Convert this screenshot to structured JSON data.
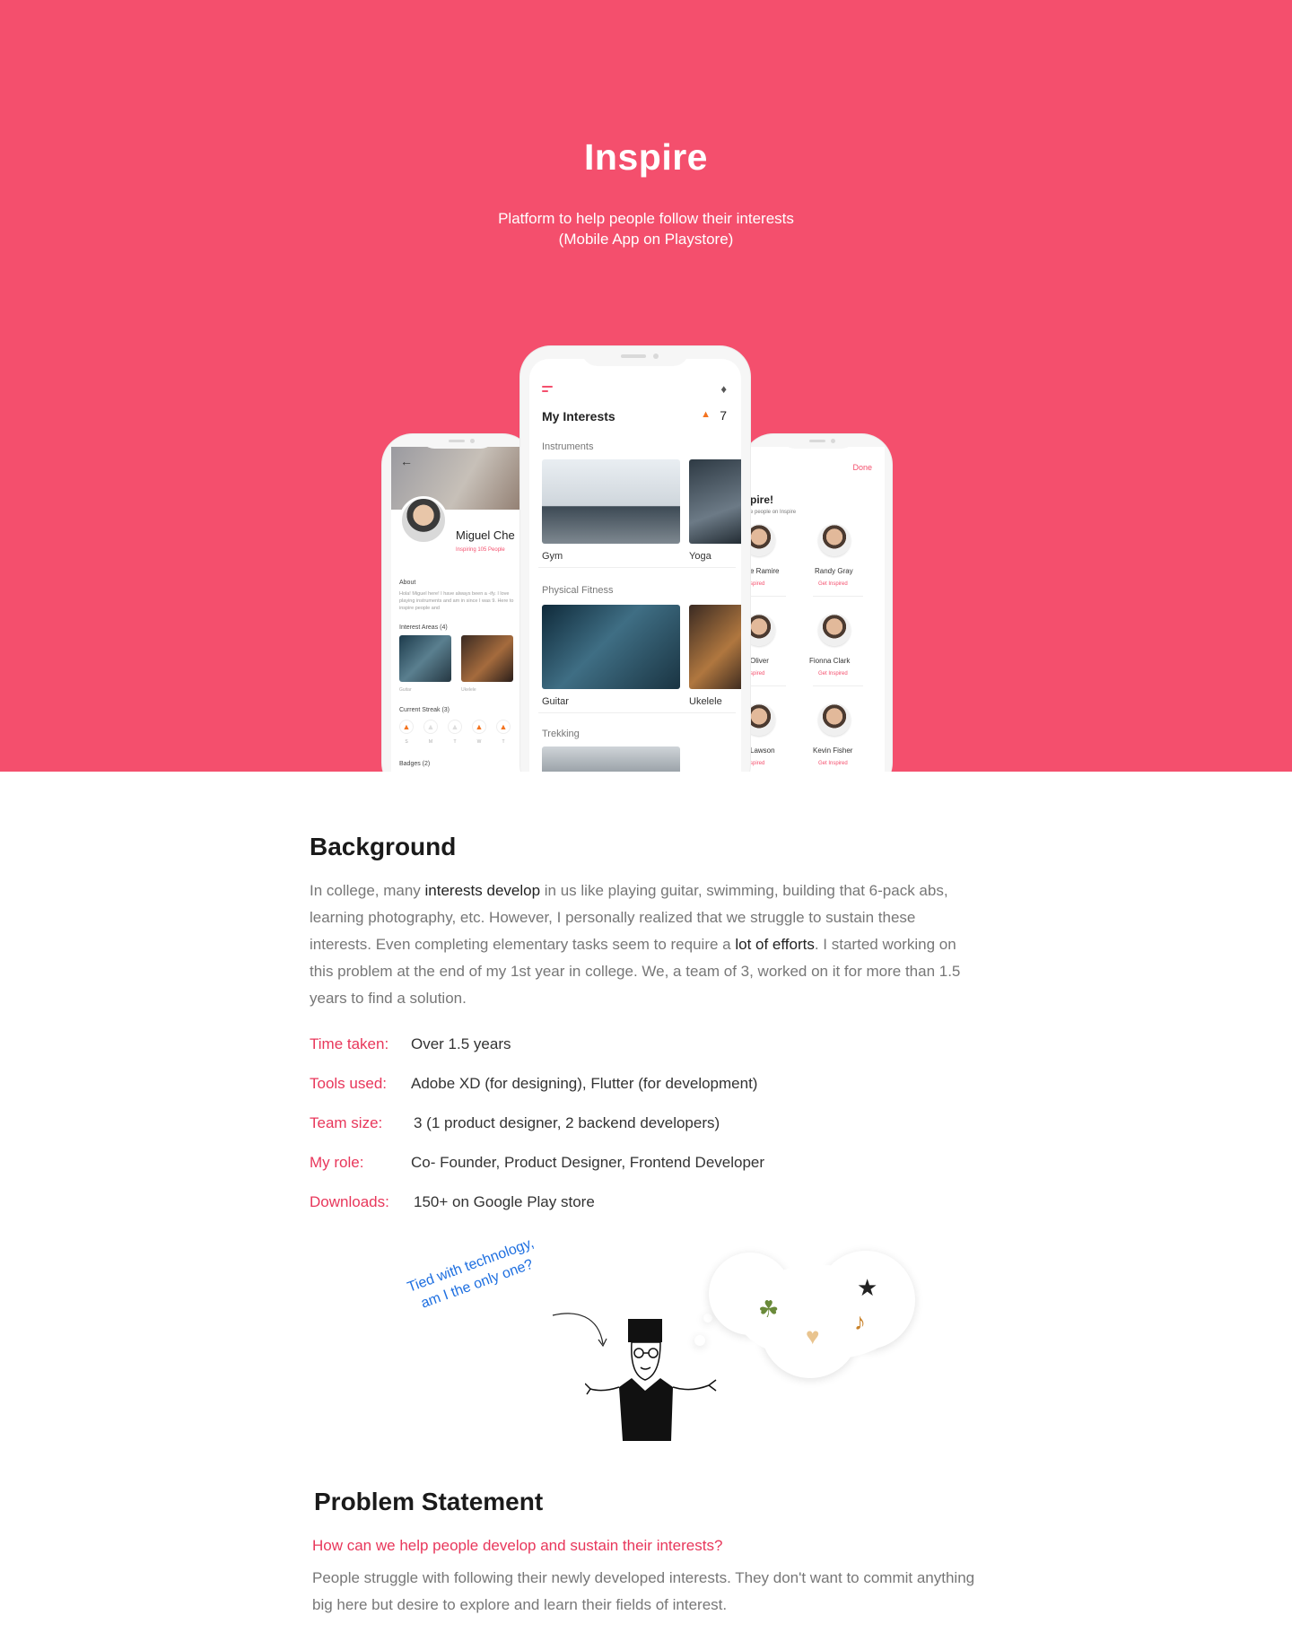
{
  "hero": {
    "title": "Inspire",
    "subtitle_line1": "Platform to help people follow their interests",
    "subtitle_line2": "(Mobile App on Playstore)"
  },
  "phone_left": {
    "back_icon": "arrow-left-icon",
    "name": "Miguel Che",
    "subtitle": "Inspiring 105 People",
    "about_label": "About",
    "about_text": "Hola! Miguel here! I have always been a -ify. I love playing instruments and am in since I was 9. Here to inspire people and",
    "interest_areas_label": "Interest Areas (4)",
    "interests": [
      "Guitar",
      "Ukelele"
    ],
    "streak_label": "Current Streak (3)",
    "days": [
      "S",
      "M",
      "T",
      "W",
      "T"
    ],
    "badges_label": "Badges (2)"
  },
  "phone_center": {
    "title": "My Interests",
    "streak_count": "7",
    "sections": [
      {
        "label": "Instruments",
        "items": [
          "Gym",
          "Yoga"
        ]
      },
      {
        "label": "Physical Fitness",
        "items": [
          "Guitar",
          "Ukelele"
        ]
      },
      {
        "label": "Trekking",
        "items": []
      }
    ]
  },
  "phone_right": {
    "done_label": "Done",
    "title": "pire!",
    "subtitle": "e people on Inspire",
    "people": [
      {
        "name": "e Ramire",
        "action": "spired"
      },
      {
        "name": "Randy Gray",
        "action": "Get Inspired"
      },
      {
        "name": "Oliver",
        "action": "spired"
      },
      {
        "name": "Fionna Clark",
        "action": "Get Inspired"
      },
      {
        "name": "Lawson",
        "action": "spired"
      },
      {
        "name": "Kevin Fisher",
        "action": "Get Inspired"
      }
    ]
  },
  "background": {
    "heading": "Background",
    "p1_a": "In college, many ",
    "p1_hl1": "interests develop",
    "p1_b": " in us like playing guitar, swimming, building that 6-pack abs, learning photography, etc. However, I personally realized that we struggle to sustain these interests. Even completing elementary tasks seem to require a ",
    "p1_hl2": "lot of efforts",
    "p1_c": ". I started working on this problem at the end of my 1st year in college. We, a team of 3, worked on it for more than 1.5 years to find a solution."
  },
  "meta": [
    {
      "label": "Time taken:",
      "value": "Over 1.5 years"
    },
    {
      "label": "Tools used:",
      "value": "Adobe XD (for designing), Flutter (for development)"
    },
    {
      "label": "Team size:",
      "value": "3 (1 product designer, 2 backend developers)"
    },
    {
      "label": "My role:",
      "value": "Co- Founder, Product Designer, Frontend Developer"
    },
    {
      "label": "Downloads:",
      "value": "150+ on Google Play store"
    }
  ],
  "illustration": {
    "note_line1": "Tied with technology,",
    "note_line2": "am I the only one?",
    "thought_icons": [
      "camera-icon",
      "plant-icon",
      "muscle-icon",
      "guitar-icon"
    ]
  },
  "problem": {
    "heading": "Problem Statement",
    "question": "How can we help people develop and sustain their interests?",
    "text": "People struggle with following their newly developed interests. They don't want to commit anything big here but desire to explore and learn their fields of interest."
  },
  "colors": {
    "brand": "#f44f6d",
    "accent_text": "#e8375b",
    "note_blue": "#1e6fe0"
  }
}
